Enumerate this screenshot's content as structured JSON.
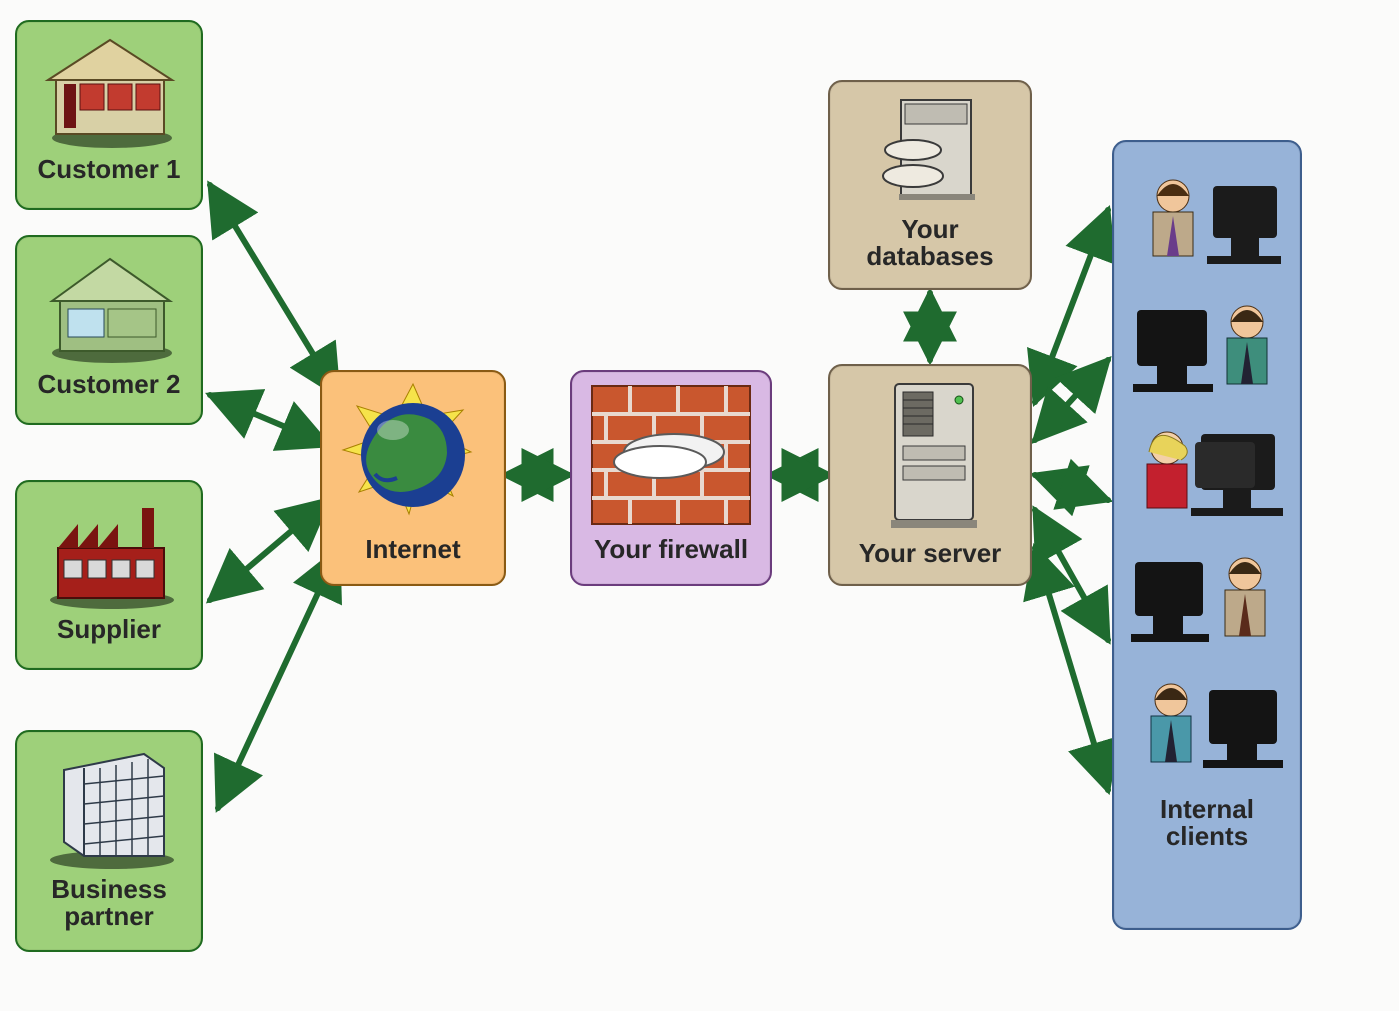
{
  "nodes": {
    "customer1": {
      "label": "Customer 1"
    },
    "customer2": {
      "label": "Customer 2"
    },
    "supplier": {
      "label": "Supplier"
    },
    "businessPartner": {
      "label": "Business\npartner"
    },
    "internet": {
      "label": "Internet"
    },
    "firewall": {
      "label": "Your firewall"
    },
    "databases": {
      "label": "Your\ndatabases"
    },
    "server": {
      "label": "Your server"
    },
    "internalClients": {
      "label": "Internal\nclients"
    }
  },
  "colors": {
    "arrow": "#1f6b2f"
  },
  "edges": [
    [
      "customer1",
      "internet"
    ],
    [
      "customer2",
      "internet"
    ],
    [
      "supplier",
      "internet"
    ],
    [
      "businessPartner",
      "internet"
    ],
    [
      "internet",
      "firewall"
    ],
    [
      "firewall",
      "server"
    ],
    [
      "databases",
      "server"
    ],
    [
      "server",
      "internalClients.c1"
    ],
    [
      "server",
      "internalClients.c2"
    ],
    [
      "server",
      "internalClients.c3"
    ],
    [
      "server",
      "internalClients.c4"
    ],
    [
      "server",
      "internalClients.c5"
    ]
  ]
}
